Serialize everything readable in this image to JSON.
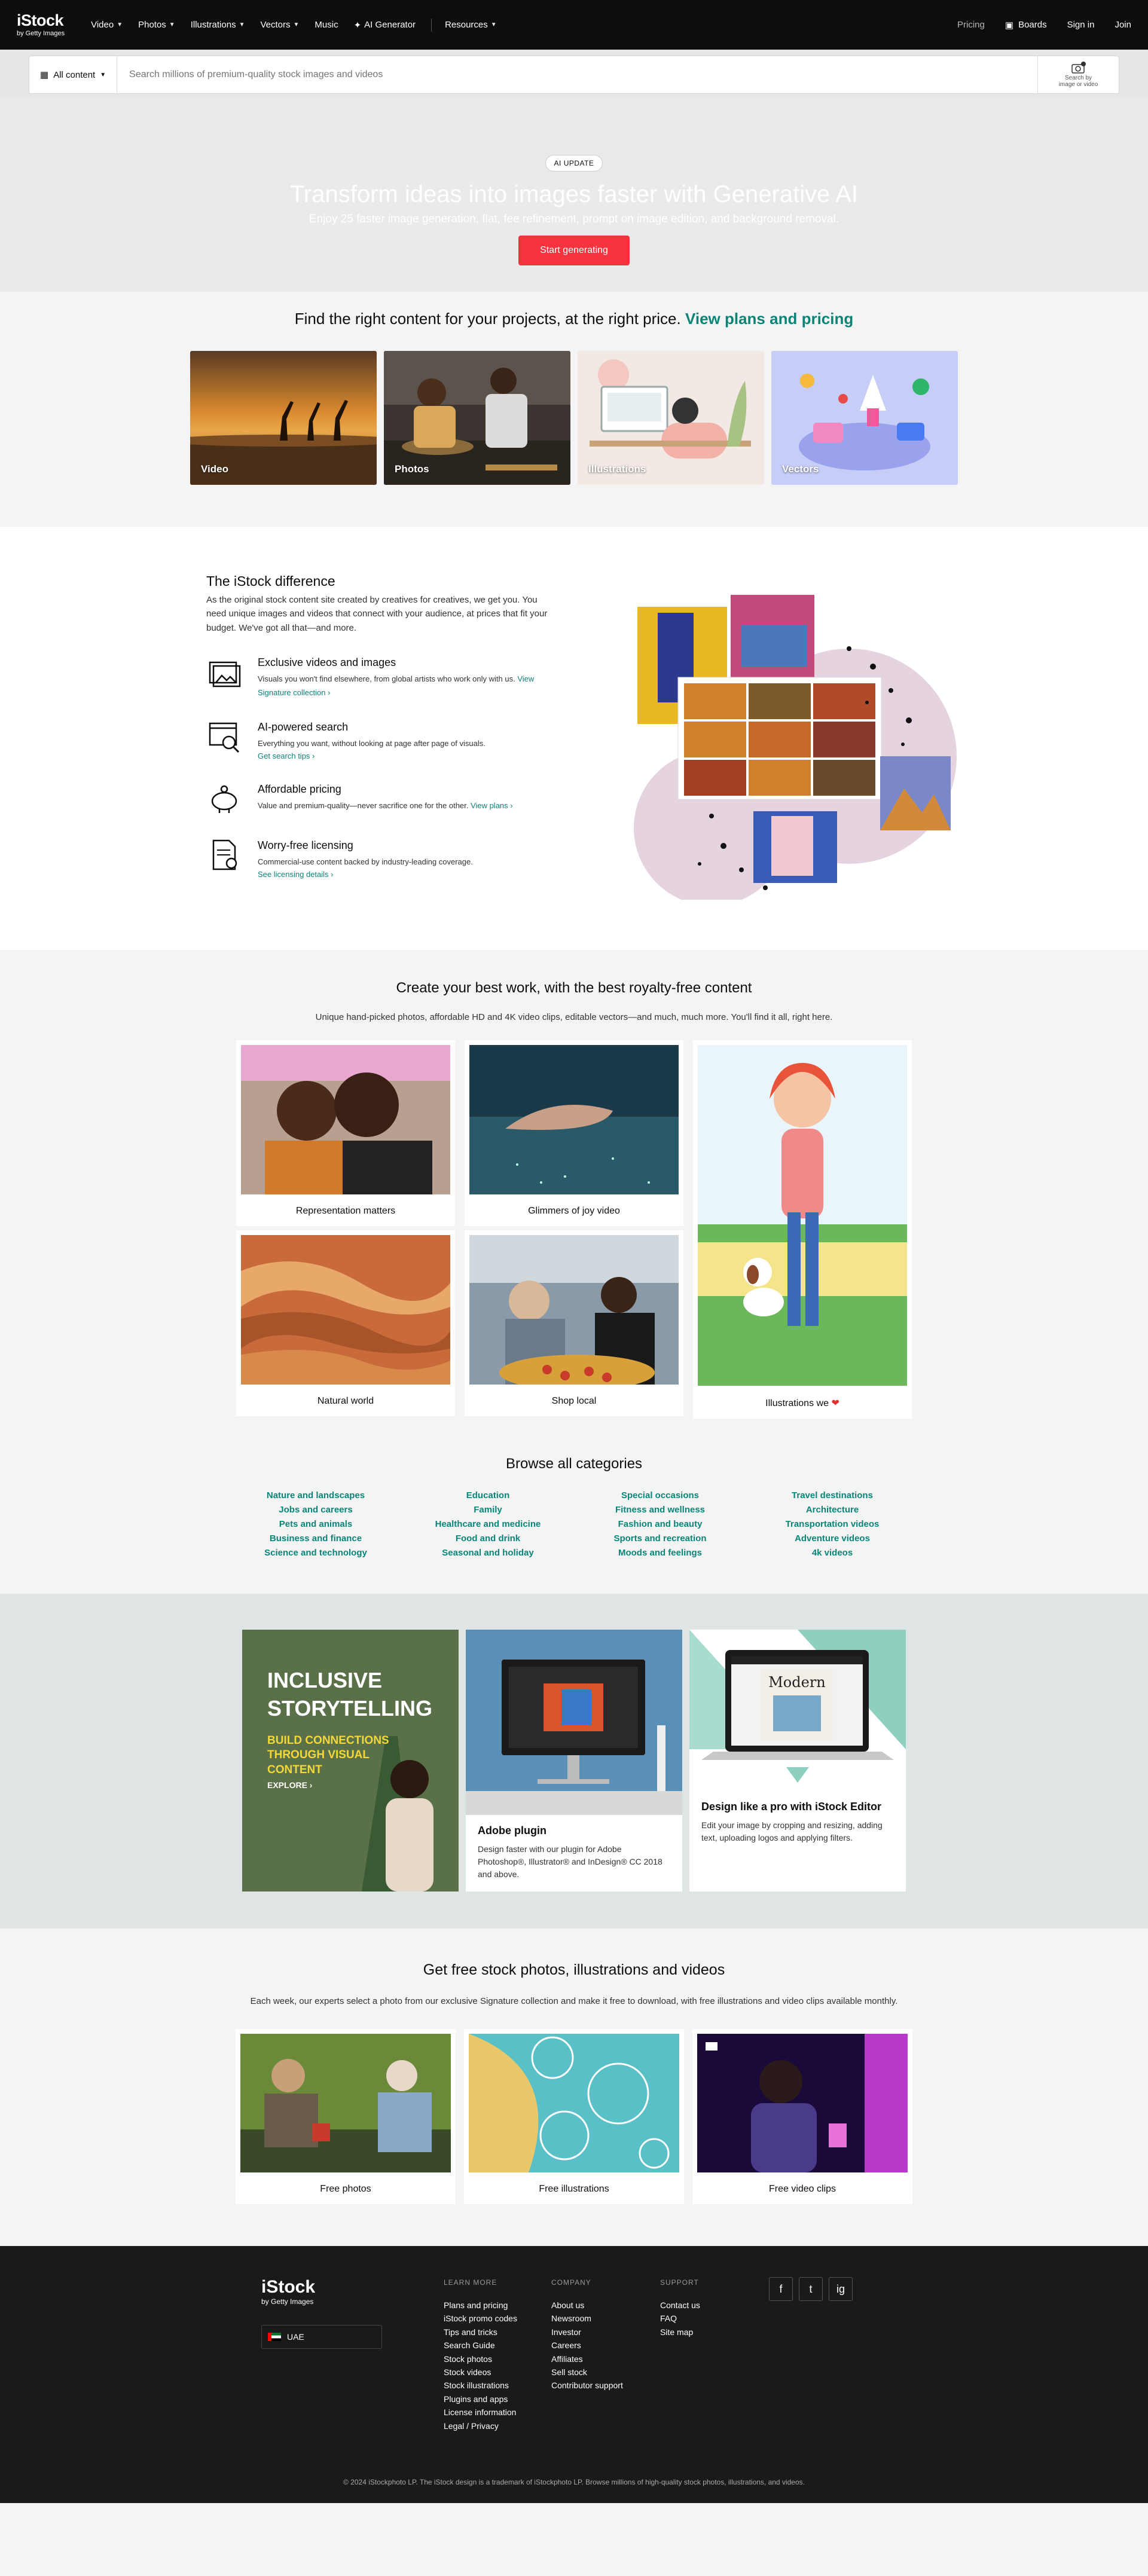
{
  "nav": {
    "logo": "iStock",
    "logo_sub": "by Getty Images",
    "items": [
      "Video",
      "Photos",
      "Illustrations",
      "Vectors"
    ],
    "music": "Music",
    "ai_generator": "AI Generator",
    "resources": "Resources",
    "pricing": "Pricing",
    "boards": "Boards",
    "signin": "Sign in",
    "join": "Join"
  },
  "search": {
    "category": "All content",
    "placeholder": "Search millions of premium-quality stock images and videos",
    "image_search": "Search by image or video"
  },
  "hero": {
    "badge": "AI UPDATE",
    "title": "Transform ideas into images faster with Generative AI",
    "subtitle": "Enjoy 25 faster image generation, flat, fee refinement, prompt on image edition, and background removal.",
    "cta": "Start generating"
  },
  "find": {
    "text": "Find the right content for your projects, at the right price.",
    "link": "View plans and pricing",
    "tiles": [
      "Video",
      "Photos",
      "Illustrations",
      "Vectors"
    ]
  },
  "difference": {
    "title": "The iStock difference",
    "intro": "As the original stock content site created by creatives for creatives, we get you. You need unique images and videos that connect with your audience, at prices that fit your budget. We've got all that—and more.",
    "features": [
      {
        "title": "Exclusive videos and images",
        "desc": "Visuals you won't find elsewhere, from global artists who work only with us.",
        "link": "View Signature collection ›"
      },
      {
        "title": "AI-powered search",
        "desc": "Everything you want, without looking at page after page of visuals.",
        "link": "Get search tips ›"
      },
      {
        "title": "Affordable pricing",
        "desc": "Value and premium-quality—never sacrifice one for the other.",
        "link": "View plans ›"
      },
      {
        "title": "Worry-free licensing",
        "desc": "Commercial-use content backed by industry-leading coverage.",
        "link": "See licensing details ›"
      }
    ]
  },
  "create": {
    "title": "Create your best work, with the best royalty-free content",
    "subtitle": "Unique hand-picked photos, affordable HD and 4K video clips, editable vectors—and much, much more. You'll find it all, right here.",
    "cards": [
      "Representation matters",
      "Glimmers of joy video",
      "Illustrations we",
      "Natural world",
      "Shop local"
    ]
  },
  "browse": {
    "title": "Browse all categories",
    "columns": [
      [
        "Nature and landscapes",
        "Jobs and careers",
        "Pets and animals",
        "Business and finance",
        "Science and technology"
      ],
      [
        "Education",
        "Family",
        "Healthcare and medicine",
        "Food and drink",
        "Seasonal and holiday"
      ],
      [
        "Special occasions",
        "Fitness and wellness",
        "Fashion and beauty",
        "Sports and recreation",
        "Moods and feelings"
      ],
      [
        "Travel destinations",
        "Architecture",
        "Transportation videos",
        "Adventure videos",
        "4k videos"
      ]
    ]
  },
  "promo": {
    "inclusive_title": "INCLUSIVE STORYTELLING",
    "inclusive_sub": "BUILD CONNECTIONS THROUGH VISUAL CONTENT",
    "inclusive_cta": "EXPLORE ›",
    "adobe_title": "Adobe plugin",
    "adobe_desc": "Design faster with our plugin for Adobe Photoshop®, Illustrator® and InDesign® CC 2018 and above.",
    "editor_title": "Design like a pro with iStock Editor",
    "editor_desc": "Edit your image by cropping and resizing, adding text, uploading logos and applying filters.",
    "magazine": "Modern"
  },
  "free": {
    "title": "Get free stock photos, illustrations and videos",
    "subtitle": "Each week, our experts select a photo from our exclusive Signature collection and make it free to download, with free illustrations and video clips available monthly.",
    "cards": [
      "Free photos",
      "Free illustrations",
      "Free video clips"
    ]
  },
  "footer": {
    "logo": "iStock",
    "logo_sub": "by Getty Images",
    "country": "UAE",
    "learn_head": "LEARN MORE",
    "learn": [
      "Plans and pricing",
      "iStock promo codes",
      "Tips and tricks",
      "Search Guide",
      "Stock photos",
      "Stock videos",
      "Stock illustrations",
      "Plugins and apps",
      "License information",
      "Legal / Privacy"
    ],
    "company_head": "COMPANY",
    "company": [
      "About us",
      "Newsroom",
      "Investor",
      "Careers",
      "Affiliates",
      "Sell stock",
      "Contributor support"
    ],
    "support_head": "SUPPORT",
    "support": [
      "Contact us",
      "FAQ",
      "Site map"
    ],
    "social": [
      "f",
      "t",
      "ig"
    ],
    "copyright": "© 2024 iStockphoto LP. The iStock design is a trademark of iStockphoto LP. Browse millions of high-quality stock photos, illustrations, and videos."
  }
}
